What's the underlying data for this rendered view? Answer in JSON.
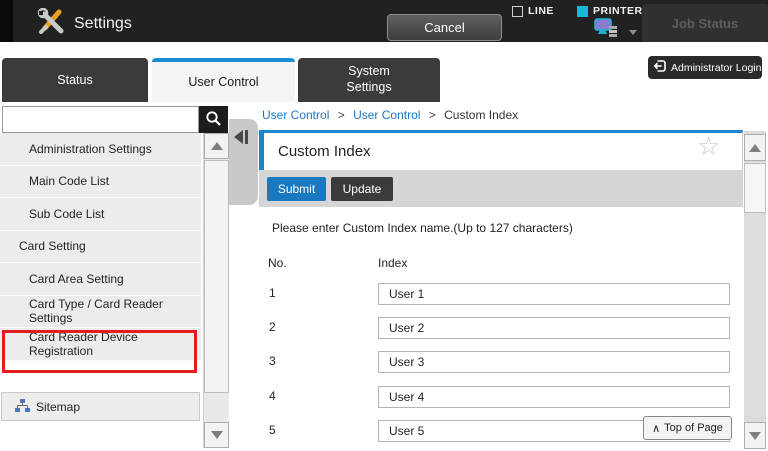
{
  "colors": {
    "accent_blue": "#1d8cd3",
    "link_blue": "#1b78c8",
    "submit_blue": "#1878c0",
    "printer_cyan": "#17b8d8",
    "highlight_red": "#e11d1d"
  },
  "top_bar": {
    "app_title": "Settings",
    "cancel_label": "Cancel",
    "line_label": "LINE",
    "printer_label": "PRINTER",
    "job_status_label": "Job Status"
  },
  "tabs": {
    "status": "Status",
    "user_control": "User Control",
    "system_settings": "System Settings"
  },
  "admin_login_label": "Administrator Login",
  "sidebar": {
    "search_value": "",
    "items": [
      {
        "label": "Administration Settings"
      },
      {
        "label": "Main Code List"
      },
      {
        "label": "Sub Code List"
      },
      {
        "label": "Card Setting"
      },
      {
        "label": "Card Area Setting"
      },
      {
        "label": "Card Type / Card Reader Settings"
      },
      {
        "label": "Card Reader Device Registration"
      }
    ],
    "sitemap_label": "Sitemap"
  },
  "breadcrumb": {
    "link1": "User Control",
    "sep1": ">",
    "link2": "User Control",
    "sep2": ">",
    "current": "Custom Index"
  },
  "main": {
    "title": "Custom Index",
    "submit_label": "Submit",
    "update_label": "Update",
    "instruction": "Please enter Custom Index name.(Up to 127 characters)",
    "table": {
      "col_no": "No.",
      "col_index": "Index",
      "rows": [
        {
          "no": "1",
          "value": "User 1"
        },
        {
          "no": "2",
          "value": "User 2"
        },
        {
          "no": "3",
          "value": "User 3"
        },
        {
          "no": "4",
          "value": "User 4"
        },
        {
          "no": "5",
          "value": "User 5"
        }
      ]
    },
    "top_of_page": {
      "icon": "∧",
      "label": "Top of Page"
    }
  }
}
